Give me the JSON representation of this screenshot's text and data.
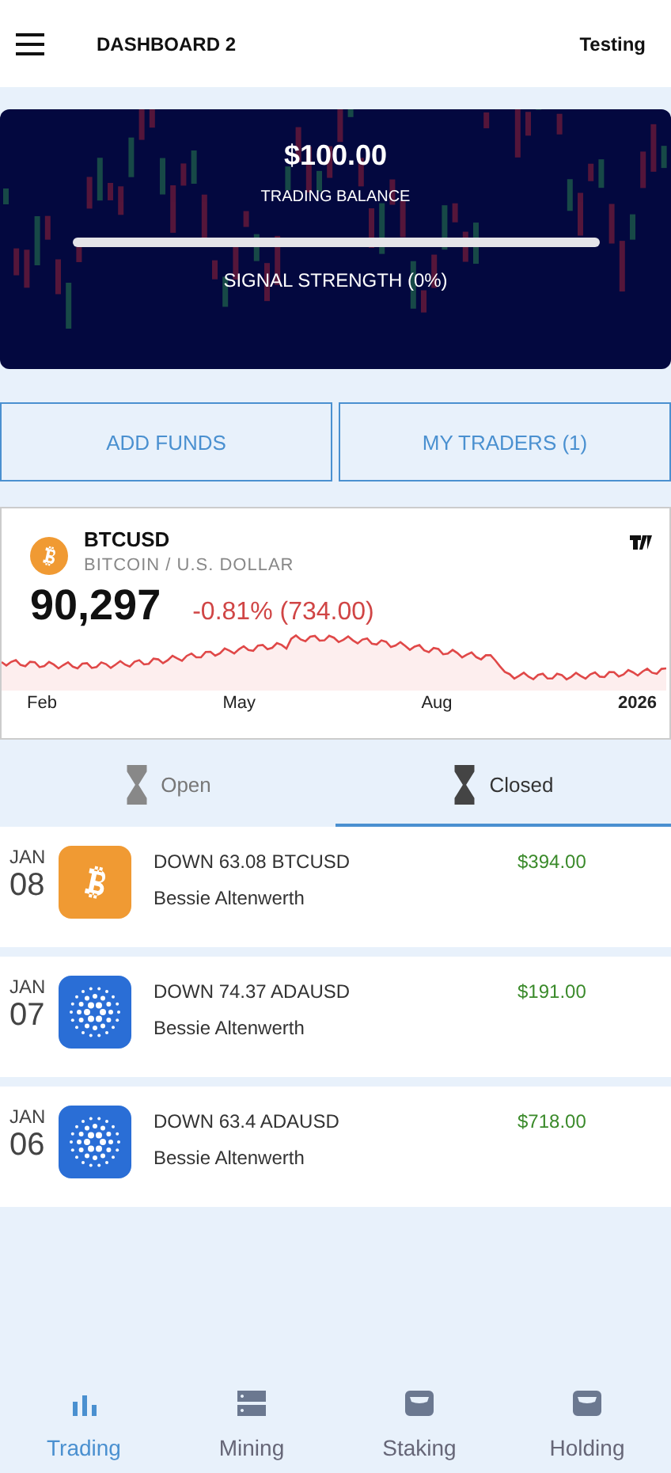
{
  "header": {
    "title": "DASHBOARD 2",
    "user": "Testing"
  },
  "balance": {
    "amount": "$100.00",
    "label": "TRADING BALANCE",
    "signal": {
      "level": 0,
      "label": "SIGNAL STRENGTH (0%)"
    }
  },
  "actions": [
    {
      "label": "ADD FUNDS"
    },
    {
      "label": "MY TRADERS (1)"
    }
  ],
  "ticker": {
    "symbol": "BTCUSD",
    "name": "BITCOIN / U.S. DOLLAR",
    "price": "90,297",
    "change": "-0.81% (734.00)",
    "axis": [
      "Feb",
      "May",
      "Aug",
      "2026"
    ]
  },
  "tabs": [
    {
      "label": "Open",
      "selected": false
    },
    {
      "label": "Closed",
      "selected": true
    }
  ],
  "trades": [
    {
      "month": "JAN",
      "day": "08",
      "kind": "btc",
      "title": "DOWN 63.08 BTCUSD",
      "trader": "Bessie Altenwerth",
      "amount": "$394.00"
    },
    {
      "month": "JAN",
      "day": "07",
      "kind": "ada",
      "title": "DOWN 74.37 ADAUSD",
      "trader": "Bessie Altenwerth",
      "amount": "$191.00"
    },
    {
      "month": "JAN",
      "day": "06",
      "kind": "ada",
      "title": "DOWN 63.4 ADAUSD",
      "trader": "Bessie Altenwerth",
      "amount": "$718.00"
    }
  ],
  "nav": [
    {
      "label": "Trading",
      "kind": "bars",
      "selected": true
    },
    {
      "label": "Mining",
      "kind": "server",
      "selected": false
    },
    {
      "label": "Staking",
      "kind": "wallet",
      "selected": false
    },
    {
      "label": "Holding",
      "kind": "wallet",
      "selected": false
    }
  ]
}
